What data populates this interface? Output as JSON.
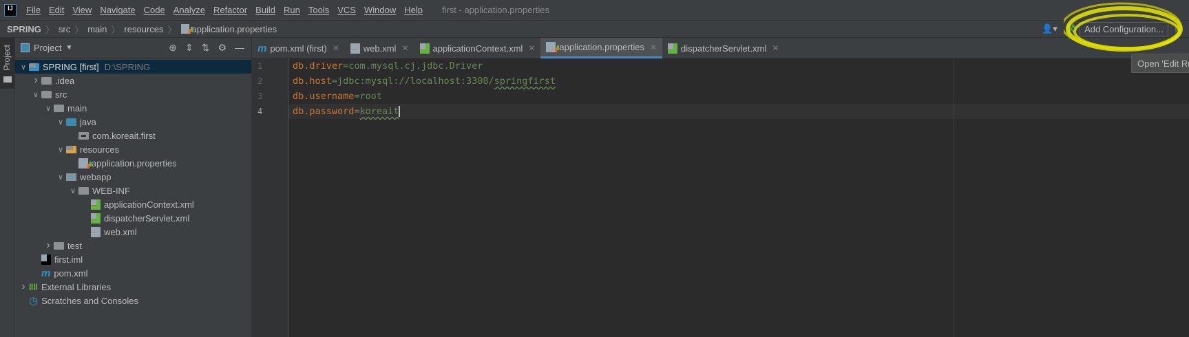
{
  "menubar": {
    "logo": "IJ",
    "items": [
      "File",
      "Edit",
      "View",
      "Navigate",
      "Code",
      "Analyze",
      "Refactor",
      "Build",
      "Run",
      "Tools",
      "VCS",
      "Window",
      "Help"
    ],
    "window_title": "first - application.properties"
  },
  "breadcrumb": [
    "SPRING",
    "src",
    "main",
    "resources",
    "application.properties"
  ],
  "toolbar": {
    "add_configuration": "Add Configuration...",
    "tooltip": "Open 'Edit Ru"
  },
  "stripe": {
    "project_label": "Project"
  },
  "project": {
    "title": "Project",
    "tree": [
      {
        "label": "SPRING [first]",
        "extra": "D:\\SPRING",
        "depth": 0,
        "arrow": "open",
        "icon": "module"
      },
      {
        "label": ".idea",
        "depth": 1,
        "arrow": "closed",
        "icon": "folder"
      },
      {
        "label": "src",
        "depth": 1,
        "arrow": "open",
        "icon": "folder"
      },
      {
        "label": "main",
        "depth": 2,
        "arrow": "open",
        "icon": "folder"
      },
      {
        "label": "java",
        "depth": 3,
        "arrow": "open",
        "icon": "source-folder"
      },
      {
        "label": "com.koreait.first",
        "depth": 4,
        "arrow": "none",
        "icon": "package"
      },
      {
        "label": "resources",
        "depth": 3,
        "arrow": "open",
        "icon": "resources-folder"
      },
      {
        "label": "application.properties",
        "depth": 4,
        "arrow": "none",
        "icon": "properties"
      },
      {
        "label": "webapp",
        "depth": 3,
        "arrow": "open",
        "icon": "web-folder"
      },
      {
        "label": "WEB-INF",
        "depth": 4,
        "arrow": "open",
        "icon": "folder"
      },
      {
        "label": "applicationContext.xml",
        "depth": 5,
        "arrow": "none",
        "icon": "spring-xml"
      },
      {
        "label": "dispatcherServlet.xml",
        "depth": 5,
        "arrow": "none",
        "icon": "spring-xml"
      },
      {
        "label": "web.xml",
        "depth": 5,
        "arrow": "none",
        "icon": "web-xml"
      },
      {
        "label": "test",
        "depth": 2,
        "arrow": "closed",
        "icon": "folder"
      },
      {
        "label": "first.iml",
        "depth": 1,
        "arrow": "none",
        "icon": "iml"
      },
      {
        "label": "pom.xml",
        "depth": 1,
        "arrow": "none",
        "icon": "maven"
      },
      {
        "label": "External Libraries",
        "depth": 0,
        "arrow": "closed",
        "icon": "libraries"
      },
      {
        "label": "Scratches and Consoles",
        "depth": 0,
        "arrow": "none",
        "icon": "scratches"
      }
    ]
  },
  "tabs": [
    {
      "label": "pom.xml (first)",
      "icon": "maven",
      "active": false
    },
    {
      "label": "web.xml",
      "icon": "web-xml",
      "active": false
    },
    {
      "label": "applicationContext.xml",
      "icon": "spring-xml",
      "active": false
    },
    {
      "label": "application.properties",
      "icon": "properties",
      "active": true
    },
    {
      "label": "dispatcherServlet.xml",
      "icon": "spring-xml",
      "active": false
    }
  ],
  "editor": {
    "current_line": 4,
    "lines": [
      {
        "n": "1",
        "key": "db.driver",
        "val": "com.mysql.cj.jdbc.Driver"
      },
      {
        "n": "2",
        "key": "db.host",
        "val": "jdbc:mysql://localhost:3308/",
        "typo": "springfirst"
      },
      {
        "n": "3",
        "key": "db.username",
        "val": "root"
      },
      {
        "n": "4",
        "key": "db.password",
        "val": "",
        "typo": "koreait"
      }
    ]
  },
  "colors": {
    "accent": "#4a88c7",
    "key": "#cc7832",
    "value": "#6a8759",
    "highlight": "#e8e800"
  }
}
